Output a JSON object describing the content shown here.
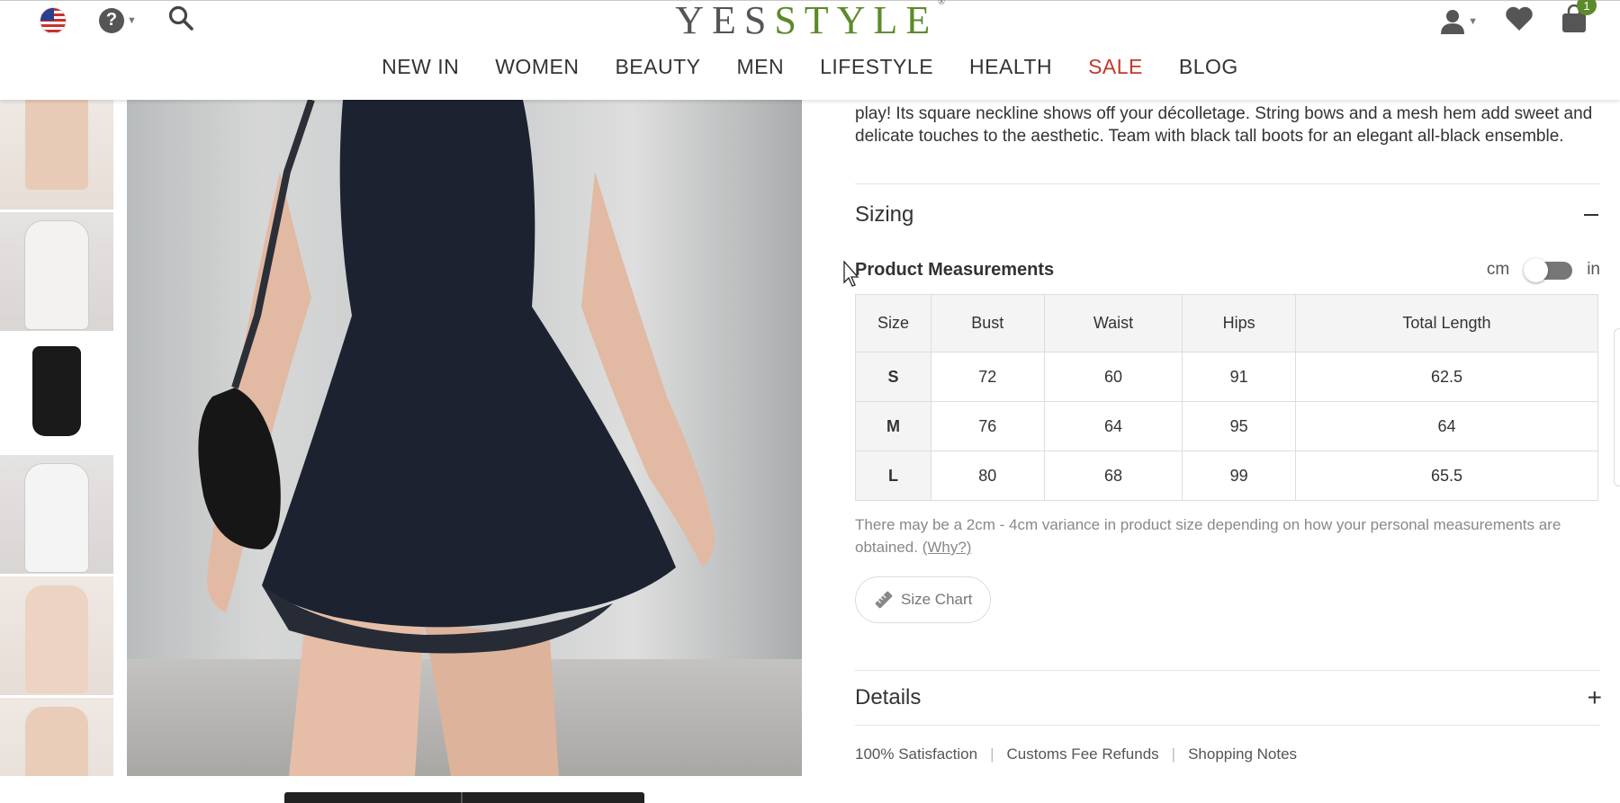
{
  "header": {
    "logo_prefix": "YES",
    "logo_suffix": "STYLE",
    "logo_mark": "®",
    "cart_count": "1",
    "help_glyph": "?",
    "icons": [
      "us-flag-icon",
      "help-icon",
      "search-icon",
      "user-icon",
      "heart-icon",
      "shopping-bag-icon"
    ]
  },
  "nav": [
    "NEW IN",
    "WOMEN",
    "BEAUTY",
    "MEN",
    "LIFESTYLE",
    "HEALTH",
    "SALE",
    "BLOG"
  ],
  "product": {
    "description": "play! Its square neckline shows off your décolletage. String bows and a mesh hem add sweet and delicate touches to the aesthetic. Team with black tall boots for an elegant all-black ensemble."
  },
  "sizing": {
    "title": "Sizing",
    "measurements_title": "Product Measurements",
    "unit_left": "cm",
    "unit_right": "in",
    "unit_selected": "cm",
    "columns": [
      "Size",
      "Bust",
      "Waist",
      "Hips",
      "Total Length"
    ],
    "rows": [
      {
        "size": "S",
        "bust": "72",
        "waist": "60",
        "hips": "91",
        "length": "62.5"
      },
      {
        "size": "M",
        "bust": "76",
        "waist": "64",
        "hips": "95",
        "length": "64"
      },
      {
        "size": "L",
        "bust": "80",
        "waist": "68",
        "hips": "99",
        "length": "65.5"
      }
    ],
    "note": "There may be a 2cm - 4cm variance in product size depending on how your personal measurements are obtained.",
    "why_link": "(Why?)",
    "size_chart_label": "Size Chart"
  },
  "details": {
    "title": "Details"
  },
  "footer_links": [
    "100% Satisfaction",
    "Customs Fee Refunds",
    "Shopping Notes"
  ],
  "colors": {
    "brand_green": "#5c8a2a",
    "sale_red": "#c0392b"
  }
}
